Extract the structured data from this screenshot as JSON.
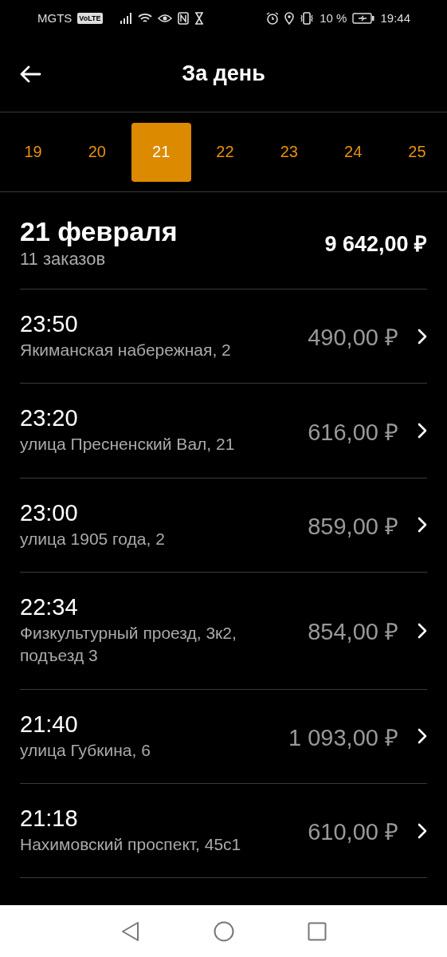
{
  "status_bar": {
    "carrier": "MGTS",
    "volte": "VoLTE",
    "battery": "10 %",
    "time": "19:44"
  },
  "header": {
    "title": "За день"
  },
  "days": [
    {
      "label": "19",
      "selected": false
    },
    {
      "label": "20",
      "selected": false
    },
    {
      "label": "21",
      "selected": true
    },
    {
      "label": "22",
      "selected": false
    },
    {
      "label": "23",
      "selected": false
    },
    {
      "label": "24",
      "selected": false
    },
    {
      "label": "25",
      "selected": false
    }
  ],
  "summary": {
    "date": "21 февраля",
    "count": "11 заказов",
    "total": "9 642,00 ₽"
  },
  "orders": [
    {
      "time": "23:50",
      "address": "Якиманская набережная, 2",
      "price": "490,00 ₽"
    },
    {
      "time": "23:20",
      "address": "улица Пресненский Вал, 21",
      "price": "616,00 ₽"
    },
    {
      "time": "23:00",
      "address": "улица 1905 года, 2",
      "price": "859,00 ₽"
    },
    {
      "time": "22:34",
      "address": "Физкультурный проезд, 3к2, подъезд 3",
      "price": "854,00 ₽"
    },
    {
      "time": "21:40",
      "address": "улица Губкина, 6",
      "price": "1 093,00 ₽"
    },
    {
      "time": "21:18",
      "address": "Нахимовский проспект, 45с1",
      "price": "610,00 ₽"
    }
  ]
}
